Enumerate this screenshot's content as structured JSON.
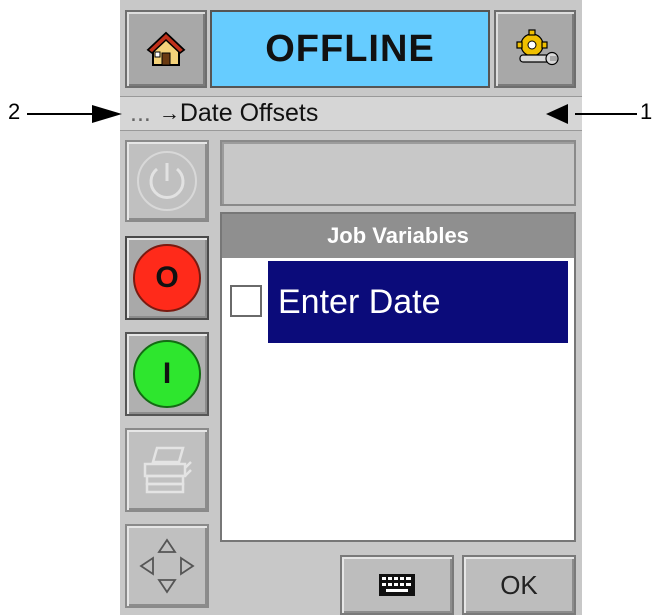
{
  "header": {
    "status": "OFFLINE",
    "home_icon": "home-icon",
    "settings_icon": "settings-gear-wrench-icon"
  },
  "breadcrumb": {
    "ellipsis": "...",
    "arrow": "→",
    "title": "Date Offsets"
  },
  "callouts": {
    "left": "2",
    "right": "1"
  },
  "sidebar": {
    "power_icon": "power-icon",
    "stop_label": "O",
    "start_label": "I",
    "printer_icon": "printer-icon",
    "navigate_icon": "arrows-icon"
  },
  "panel": {
    "title": "Job Variables",
    "items": [
      {
        "label": "Enter Date",
        "checked": false
      }
    ]
  },
  "footer": {
    "keyboard_icon": "keyboard-icon",
    "ok_label": "OK"
  },
  "colors": {
    "status_bg": "#66ccff",
    "selection_bg": "#0b0b7a",
    "stop": "#ff2a1a",
    "start": "#2ee62e"
  }
}
